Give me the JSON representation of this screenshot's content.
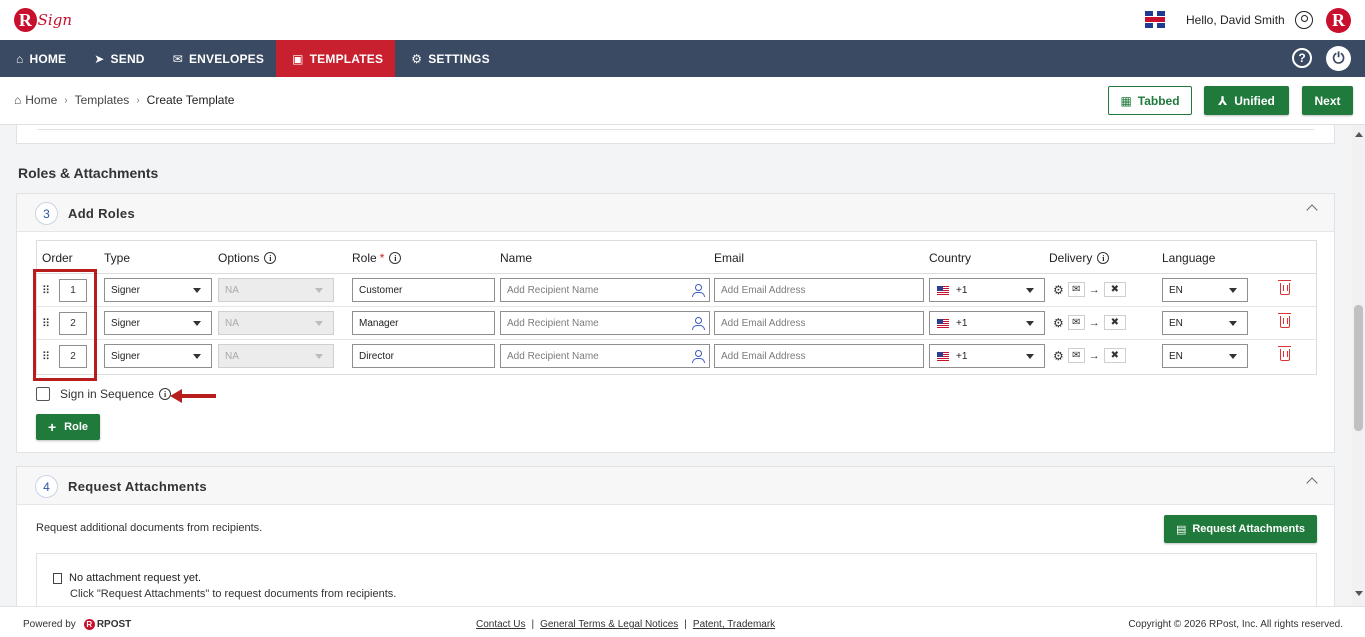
{
  "header": {
    "logo_text": "Sign",
    "logo_letter": "R",
    "greeting": "Hello, David Smith",
    "avatar_letter": "R"
  },
  "nav": {
    "items": [
      {
        "label": "HOME",
        "icon": "home-icon"
      },
      {
        "label": "SEND",
        "icon": "send-icon"
      },
      {
        "label": "ENVELOPES",
        "icon": "envelope-icon"
      },
      {
        "label": "TEMPLATES",
        "icon": "template-icon",
        "active": true
      },
      {
        "label": "SETTINGS",
        "icon": "gear-icon"
      }
    ],
    "help": "?",
    "power": "⏻"
  },
  "breadcrumb": {
    "items": [
      "Home",
      "Templates",
      "Create Template"
    ]
  },
  "toolbar": {
    "tabbed_label": "Tabbed",
    "unified_label": "Unified",
    "next_label": "Next"
  },
  "section": {
    "title": "Roles & Attachments"
  },
  "add_roles": {
    "step": "3",
    "title": "Add Roles",
    "columns": {
      "order": "Order",
      "type": "Type",
      "options": "Options",
      "role": "Role",
      "role_required": "*",
      "name": "Name",
      "email": "Email",
      "country": "Country",
      "delivery": "Delivery",
      "language": "Language"
    },
    "name_placeholder": "Add Recipient Name",
    "email_placeholder": "Add Email Address",
    "rows": [
      {
        "order": "1",
        "type": "Signer",
        "options": "NA",
        "role": "Customer",
        "country_code": "+1",
        "language": "EN"
      },
      {
        "order": "2",
        "type": "Signer",
        "options": "NA",
        "role": "Manager",
        "country_code": "+1",
        "language": "EN"
      },
      {
        "order": "2",
        "type": "Signer",
        "options": "NA",
        "role": "Director",
        "country_code": "+1",
        "language": "EN"
      }
    ],
    "sign_in_sequence": "Sign in Sequence",
    "add_role_label": "Role",
    "add_role_plus": "+"
  },
  "attachments": {
    "step": "4",
    "title": "Request Attachments",
    "description": "Request additional documents from recipients.",
    "button_label": "Request Attachments",
    "empty_title": "No attachment request yet.",
    "empty_hint": "Click \"Request Attachments\" to request documents from recipients."
  },
  "footer": {
    "powered_by": "Powered by",
    "brand": "RPOST",
    "links": [
      "Contact Us",
      "General Terms & Legal Notices",
      "Patent, Trademark"
    ],
    "separator": "|",
    "copyright": "Copyright © 2026 RPost, Inc. All rights reserved."
  },
  "colors": {
    "brand_red": "#c8102e",
    "nav_bg": "#3a4a63",
    "active_tab": "#c8202f",
    "primary_green": "#1f7a3c",
    "annotation_red": "#b81d1d"
  }
}
